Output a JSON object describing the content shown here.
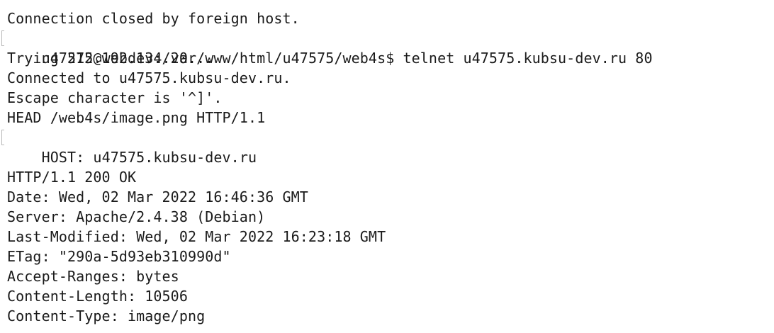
{
  "terminal": {
    "lines": [
      "Connection closed by foreign host.",
      "u47575@webdev:/var/www/html/u47575/web4s$ telnet u47575.kubsu-dev.ru 80",
      "Trying 212.192.134.20...",
      "Connected to u47575.kubsu-dev.ru.",
      "Escape character is '^]'.",
      "HEAD /web4s/image.png HTTP/1.1",
      "HOST: u47575.kubsu-dev.ru",
      "",
      "HTTP/1.1 200 OK",
      "Date: Wed, 02 Mar 2022 16:46:36 GMT",
      "Server: Apache/2.4.38 (Debian)",
      "Last-Modified: Wed, 02 Mar 2022 16:23:18 GMT",
      "ETag: \"290a-5d93eb310990d\"",
      "Accept-Ranges: bytes",
      "Content-Length: 10506",
      "Content-Type: image/png"
    ]
  }
}
